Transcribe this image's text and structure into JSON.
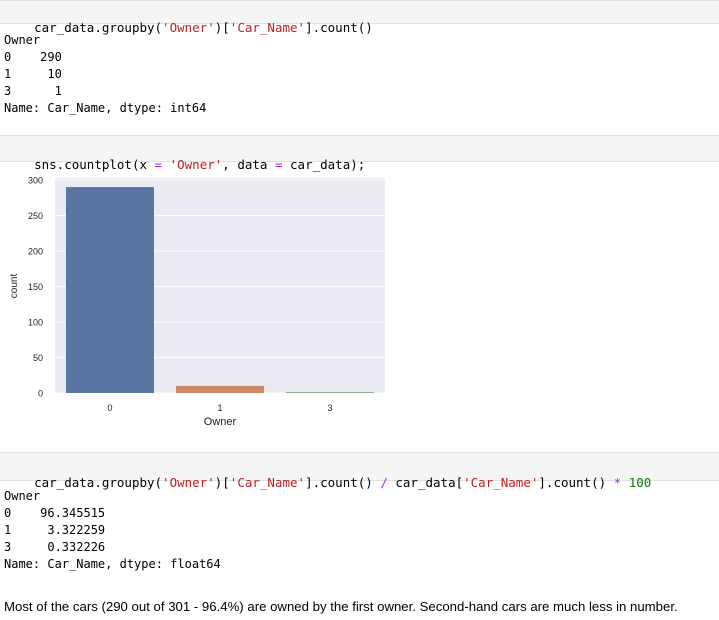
{
  "cells": {
    "c1": {
      "parts": [
        "car_data.groupby(",
        "'Owner'",
        ")[",
        "'Car_Name'",
        "].count()"
      ],
      "output": [
        "Owner",
        "0    290",
        "1     10",
        "3      1",
        "Name: Car_Name, dtype: int64"
      ]
    },
    "c2": {
      "parts": [
        "sns.countplot(x ",
        "=",
        " ",
        "'Owner'",
        ", data ",
        "=",
        " car_data);"
      ]
    },
    "c3": {
      "parts": [
        "car_data.groupby(",
        "'Owner'",
        ")[",
        "'Car_Name'",
        "].count() ",
        "/",
        " car_data[",
        "'Car_Name'",
        "].count() ",
        "*",
        " ",
        "100"
      ],
      "output": [
        "Owner",
        "0    96.345515",
        "1     3.322259",
        "3     0.332226",
        "Name: Car_Name, dtype: float64"
      ]
    }
  },
  "chart_data": {
    "type": "bar",
    "categories": [
      "0",
      "1",
      "3"
    ],
    "values": [
      290,
      10,
      1
    ],
    "colors": [
      "#5875a4",
      "#cc8963",
      "#5f9e6e"
    ],
    "background": "#eaeaf2",
    "xlabel": "Owner",
    "ylabel": "count",
    "ylim": [
      0,
      300
    ],
    "yticks": [
      "0",
      "50",
      "100",
      "150",
      "200",
      "250",
      "300"
    ],
    "grid": true
  },
  "markdown": {
    "text": "Most of the cars (290 out of 301 - 96.4%) are owned by the first owner. Second-hand cars are much less in number."
  }
}
